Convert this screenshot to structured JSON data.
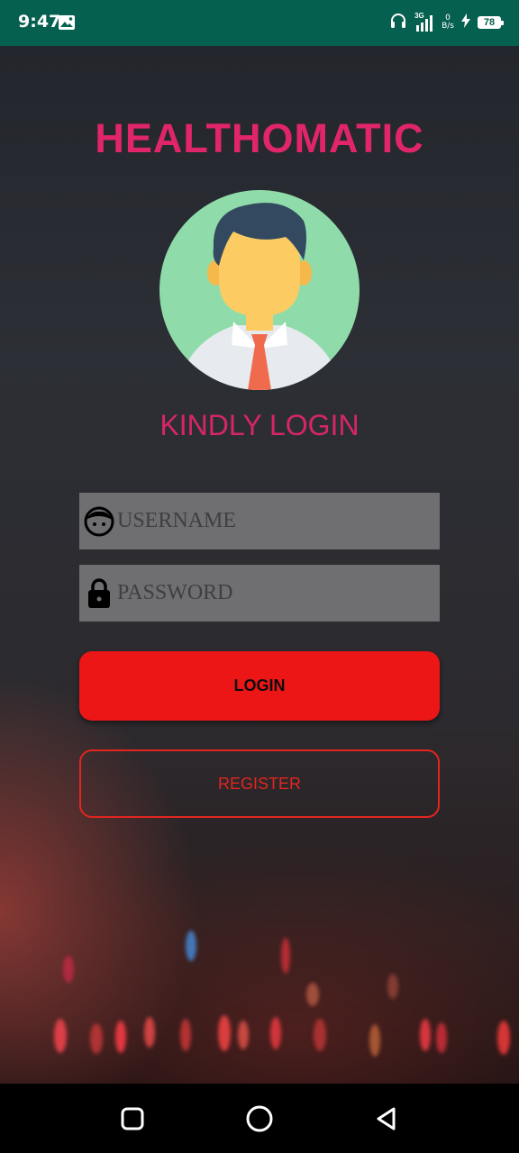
{
  "status_bar": {
    "time": "9:47",
    "network_type": "3G",
    "net_speed_value": "0",
    "net_speed_unit": "B/s",
    "battery_level": "78"
  },
  "login_screen": {
    "app_title": "HEALTHOMATIC",
    "subtitle": "KINDLY LOGIN",
    "username_placeholder": "USERNAME",
    "password_placeholder": "PASSWORD",
    "login_label": "LOGIN",
    "register_label": "REGISTER"
  },
  "icons": {
    "status": [
      "gallery-icon",
      "headphones-icon",
      "signal-icon",
      "charging-icon",
      "battery-icon"
    ],
    "fields": [
      "face-icon",
      "lock-icon"
    ],
    "nav": [
      "recents-icon",
      "home-icon",
      "back-icon"
    ]
  },
  "colors": {
    "status_bar": "#06604f",
    "title": "#e0256a",
    "login_button": "#ec1616",
    "register_border": "#e3251f",
    "input_background": "#6f6f72"
  }
}
